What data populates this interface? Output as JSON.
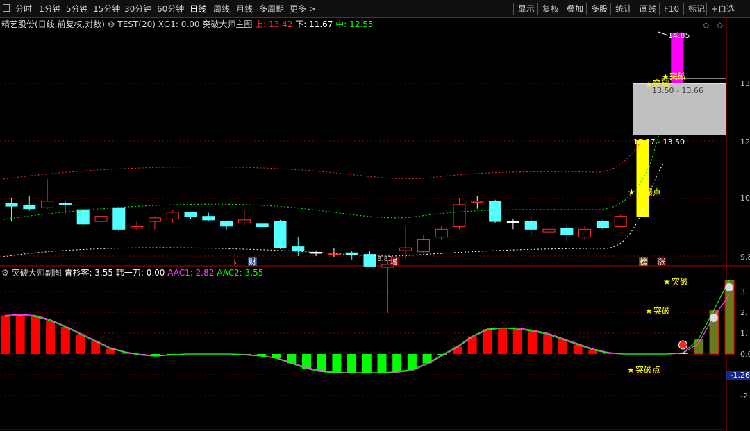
{
  "toolbar": {
    "periods": [
      "分时",
      "1分钟",
      "5分钟",
      "15分钟",
      "30分钟",
      "60分钟",
      "日线",
      "周线",
      "月线",
      "多周期",
      "更多 >"
    ],
    "active_period": "日线",
    "tools": [
      "显示",
      "复权",
      "叠加",
      "多股",
      "统计",
      "画线",
      "F10",
      "标记",
      "+自选"
    ]
  },
  "main_info": {
    "stock": "精艺股份(日线,前复权,对数)",
    "indicator": "TEST(20)",
    "xg1": "XG1: 0.00",
    "title": "突破大师主图",
    "up": "上: 13.42",
    "down": "下: 11.67",
    "mid": "中: 12.55"
  },
  "sub_info": {
    "title": "突破大师副图",
    "qsk": "青衫客: 3.55",
    "hyd": "韩一刀: 0.00",
    "aac1": "AAC1: 2.82",
    "aac2": "AAC2: 3.55"
  },
  "main_axis": [
    "13.5",
    "12.1",
    "10.5",
    "9.8"
  ],
  "sub_axis": [
    "3.",
    "2.",
    "1.",
    "0.0",
    "-1.",
    "-2."
  ],
  "cursor_value": "-1.26",
  "annotations": {
    "high_price": "14.85",
    "breakout_top": "突破",
    "breakout_box": "突破",
    "zone_upper": "13.50 - 13.66",
    "zone_lower": "12.27 - 13.50",
    "launch_point": "起爆点",
    "sub_breakout_1": "突破",
    "sub_breakout_2": "突破",
    "sub_breakout_point": "突破点",
    "low_price": "8.82"
  },
  "markers": {
    "dollar": "$",
    "cai": "财",
    "zeng": "增",
    "bang": "榜",
    "zhang": "涨"
  },
  "colors": {
    "up": "#ff3232",
    "down": "#54ffff",
    "background": "#000000",
    "highlight_yellow": "#ffff00",
    "highlight_magenta": "#ff00ff",
    "breakout_zone": "#c0c0c0"
  },
  "chart_data": [
    {
      "type": "candlestick",
      "title": "突破大师主图",
      "candles": [
        {
          "o": 10.8,
          "c": 10.75,
          "h": 10.92,
          "l": 10.45
        },
        {
          "o": 10.76,
          "c": 10.7,
          "h": 10.95,
          "l": 10.66
        },
        {
          "o": 10.72,
          "c": 10.85,
          "h": 11.3,
          "l": 10.7
        },
        {
          "o": 10.8,
          "c": 10.78,
          "h": 10.85,
          "l": 10.6
        },
        {
          "o": 10.68,
          "c": 10.4,
          "h": 10.7,
          "l": 10.35
        },
        {
          "o": 10.45,
          "c": 10.55,
          "h": 10.6,
          "l": 10.35
        },
        {
          "o": 10.72,
          "c": 10.3,
          "h": 10.75,
          "l": 10.25
        },
        {
          "o": 10.32,
          "c": 10.35,
          "h": 10.45,
          "l": 10.28
        },
        {
          "o": 10.45,
          "c": 10.52,
          "h": 10.55,
          "l": 10.3
        },
        {
          "o": 10.5,
          "c": 10.63,
          "h": 10.68,
          "l": 10.42
        },
        {
          "o": 10.62,
          "c": 10.55,
          "h": 10.64,
          "l": 10.5
        },
        {
          "o": 10.55,
          "c": 10.48,
          "h": 10.62,
          "l": 10.45
        },
        {
          "o": 10.45,
          "c": 10.36,
          "h": 10.47,
          "l": 10.28
        },
        {
          "o": 10.42,
          "c": 10.48,
          "h": 10.66,
          "l": 10.38
        },
        {
          "o": 10.4,
          "c": 10.35,
          "h": 10.43,
          "l": 10.32
        },
        {
          "o": 10.45,
          "c": 9.95,
          "h": 10.48,
          "l": 9.93
        },
        {
          "o": 9.97,
          "c": 9.9,
          "h": 10.15,
          "l": 9.8
        },
        {
          "o": 9.87,
          "c": 9.86,
          "h": 9.9,
          "l": 9.8
        },
        {
          "o": 9.85,
          "c": 9.85,
          "h": 9.95,
          "l": 9.78
        },
        {
          "o": 9.86,
          "c": 9.83,
          "h": 9.9,
          "l": 9.74
        },
        {
          "o": 9.83,
          "c": 9.62,
          "h": 9.9,
          "l": 9.6
        },
        {
          "o": 9.6,
          "c": 9.65,
          "h": 9.72,
          "l": 8.82
        },
        {
          "o": 9.9,
          "c": 9.95,
          "h": 10.35,
          "l": 9.75
        },
        {
          "o": 9.88,
          "c": 10.1,
          "h": 10.2,
          "l": 9.85
        },
        {
          "o": 10.15,
          "c": 10.3,
          "h": 10.36,
          "l": 10.1
        },
        {
          "o": 10.35,
          "c": 10.78,
          "h": 10.9,
          "l": 10.3
        },
        {
          "o": 10.85,
          "c": 10.85,
          "h": 10.95,
          "l": 10.7
        },
        {
          "o": 10.85,
          "c": 10.45,
          "h": 10.88,
          "l": 10.42
        },
        {
          "o": 10.45,
          "c": 10.43,
          "h": 10.5,
          "l": 10.3
        },
        {
          "o": 10.45,
          "c": 10.3,
          "h": 10.55,
          "l": 10.2
        },
        {
          "o": 10.25,
          "c": 10.3,
          "h": 10.4,
          "l": 10.2
        },
        {
          "o": 10.32,
          "c": 10.2,
          "h": 10.38,
          "l": 10.08
        },
        {
          "o": 10.15,
          "c": 10.3,
          "h": 10.36,
          "l": 10.1
        },
        {
          "o": 10.45,
          "c": 10.33,
          "h": 10.48,
          "l": 10.3
        },
        {
          "o": 10.35,
          "c": 10.55,
          "h": 10.58,
          "l": 10.34
        },
        {
          "o": 10.55,
          "c": 12.15,
          "h": 12.15,
          "l": 10.55
        },
        {
          "o": 13.5,
          "c": 14.8,
          "h": 14.85,
          "l": 13.5
        }
      ],
      "y_axis_ticks": [
        13.5,
        12.1,
        10.5,
        9.8
      ],
      "scale": "log"
    },
    {
      "type": "bar",
      "title": "突破大师副图",
      "series": [
        {
          "name": "青衫客",
          "values": [
            1.85,
            1.85,
            1.8,
            1.6,
            1.3,
            0.95,
            0.6,
            0.25,
            0.08,
            -0.05,
            -0.1,
            -0.05,
            0.0,
            0.0,
            0.0,
            0.0,
            -0.05,
            -0.1,
            -0.2,
            -0.45,
            -0.7,
            -0.85,
            -0.9,
            -0.9,
            -0.9,
            -0.9,
            -0.85,
            -0.75,
            -0.45,
            -0.05,
            0.35,
            0.85,
            1.2,
            1.25,
            1.2,
            1.1,
            0.95,
            0.7,
            0.45,
            0.2,
            0.05,
            0.0,
            0.0,
            0.0,
            0.0,
            0.06,
            0.7,
            2.1,
            3.55
          ]
        },
        {
          "name": "AAC1",
          "values": [
            1.85,
            1.9,
            1.85,
            1.65,
            1.35,
            1.0,
            0.65,
            0.3,
            0.1,
            -0.02,
            -0.08,
            -0.05,
            0.0,
            0.0,
            0.0,
            0.0,
            -0.03,
            -0.08,
            -0.18,
            -0.4,
            -0.65,
            -0.8,
            -0.88,
            -0.9,
            -0.9,
            -0.9,
            -0.88,
            -0.8,
            -0.5,
            -0.1,
            0.3,
            0.8,
            1.15,
            1.25,
            1.25,
            1.15,
            1.0,
            0.75,
            0.5,
            0.25,
            0.08,
            0.0,
            0.0,
            0.0,
            0.0,
            0.04,
            0.5,
            1.8,
            2.82
          ]
        },
        {
          "name": "AAC2",
          "values": [
            1.8,
            1.85,
            1.8,
            1.6,
            1.3,
            0.95,
            0.6,
            0.25,
            0.08,
            -0.05,
            -0.1,
            -0.05,
            0.0,
            0.0,
            0.0,
            0.0,
            -0.05,
            -0.1,
            -0.2,
            -0.45,
            -0.7,
            -0.85,
            -0.9,
            -0.9,
            -0.9,
            -0.9,
            -0.85,
            -0.75,
            -0.45,
            -0.05,
            0.35,
            0.85,
            1.2,
            1.25,
            1.2,
            1.1,
            0.95,
            0.7,
            0.45,
            0.2,
            0.05,
            0.0,
            0.0,
            0.0,
            0.0,
            0.06,
            0.7,
            2.1,
            3.55
          ]
        }
      ],
      "y_axis_ticks": [
        3,
        2,
        1,
        0,
        -1,
        -2
      ]
    }
  ]
}
